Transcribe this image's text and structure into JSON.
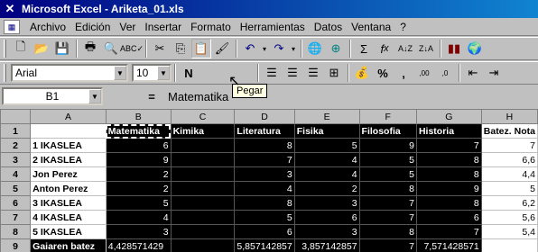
{
  "window": {
    "title": "Microsoft Excel - Ariketa_01.xls",
    "app_icon": "excel-icon"
  },
  "menu": [
    "Archivo",
    "Edición",
    "Ver",
    "Insertar",
    "Formato",
    "Herramientas",
    "Datos",
    "Ventana",
    "?"
  ],
  "toolbar_standard": {
    "buttons": [
      "new-icon",
      "open-icon",
      "save-icon",
      "print-icon",
      "print-preview-icon",
      "spelling-icon",
      "cut-icon",
      "copy-icon",
      "paste-icon",
      "format-painter-icon",
      "undo-icon",
      "redo-icon",
      "hyperlink-icon",
      "web-icon",
      "autosum-icon",
      "function-icon",
      "sort-asc-icon",
      "sort-desc-icon",
      "chart-wizard-icon",
      "map-icon"
    ]
  },
  "toolbar_format": {
    "font": "Arial",
    "size": "10",
    "tooltip": "Pegar",
    "buttons": [
      "bold-icon",
      "align-left-icon",
      "center-icon",
      "align-right-icon",
      "merge-center-icon",
      "currency-icon",
      "percent-icon",
      "comma-icon",
      "increase-decimal-icon",
      "decrease-decimal-icon",
      "decrease-indent-icon",
      "increase-indent-icon"
    ]
  },
  "formula_bar": {
    "cell_ref": "B1",
    "equals": "=",
    "content": "Matematika"
  },
  "sheet": {
    "columns": [
      "A",
      "B",
      "C",
      "D",
      "E",
      "F",
      "G",
      "H"
    ],
    "row_numbers": [
      "1",
      "2",
      "3",
      "4",
      "5",
      "6",
      "7",
      "8",
      "9"
    ],
    "headers": [
      "",
      "Matematika",
      "Kimika",
      "Literatura",
      "Fisika",
      "Filosofia",
      "Historia",
      "Batez. Nota"
    ],
    "rows": [
      [
        "1 IKASLEA",
        "6",
        "",
        "8",
        "5",
        "9",
        "7",
        "7"
      ],
      [
        "2 IKASLEA",
        "9",
        "",
        "7",
        "4",
        "5",
        "8",
        "6,6"
      ],
      [
        "Jon Perez",
        "2",
        "",
        "3",
        "4",
        "5",
        "8",
        "4,4"
      ],
      [
        "Anton Perez",
        "2",
        "",
        "4",
        "2",
        "8",
        "9",
        "5"
      ],
      [
        "3 IKASLEA",
        "5",
        "",
        "8",
        "3",
        "7",
        "8",
        "6,2"
      ],
      [
        "4 IKASLEA",
        "4",
        "",
        "5",
        "6",
        "7",
        "6",
        "5,6"
      ],
      [
        "5 IKASLEA",
        "3",
        "",
        "6",
        "3",
        "8",
        "7",
        "5,4"
      ]
    ],
    "average_row": [
      "Gaiaren batez",
      "4,428571429",
      "",
      "5,857142857",
      "3,857142857",
      "7",
      "7,571428571",
      ""
    ]
  }
}
